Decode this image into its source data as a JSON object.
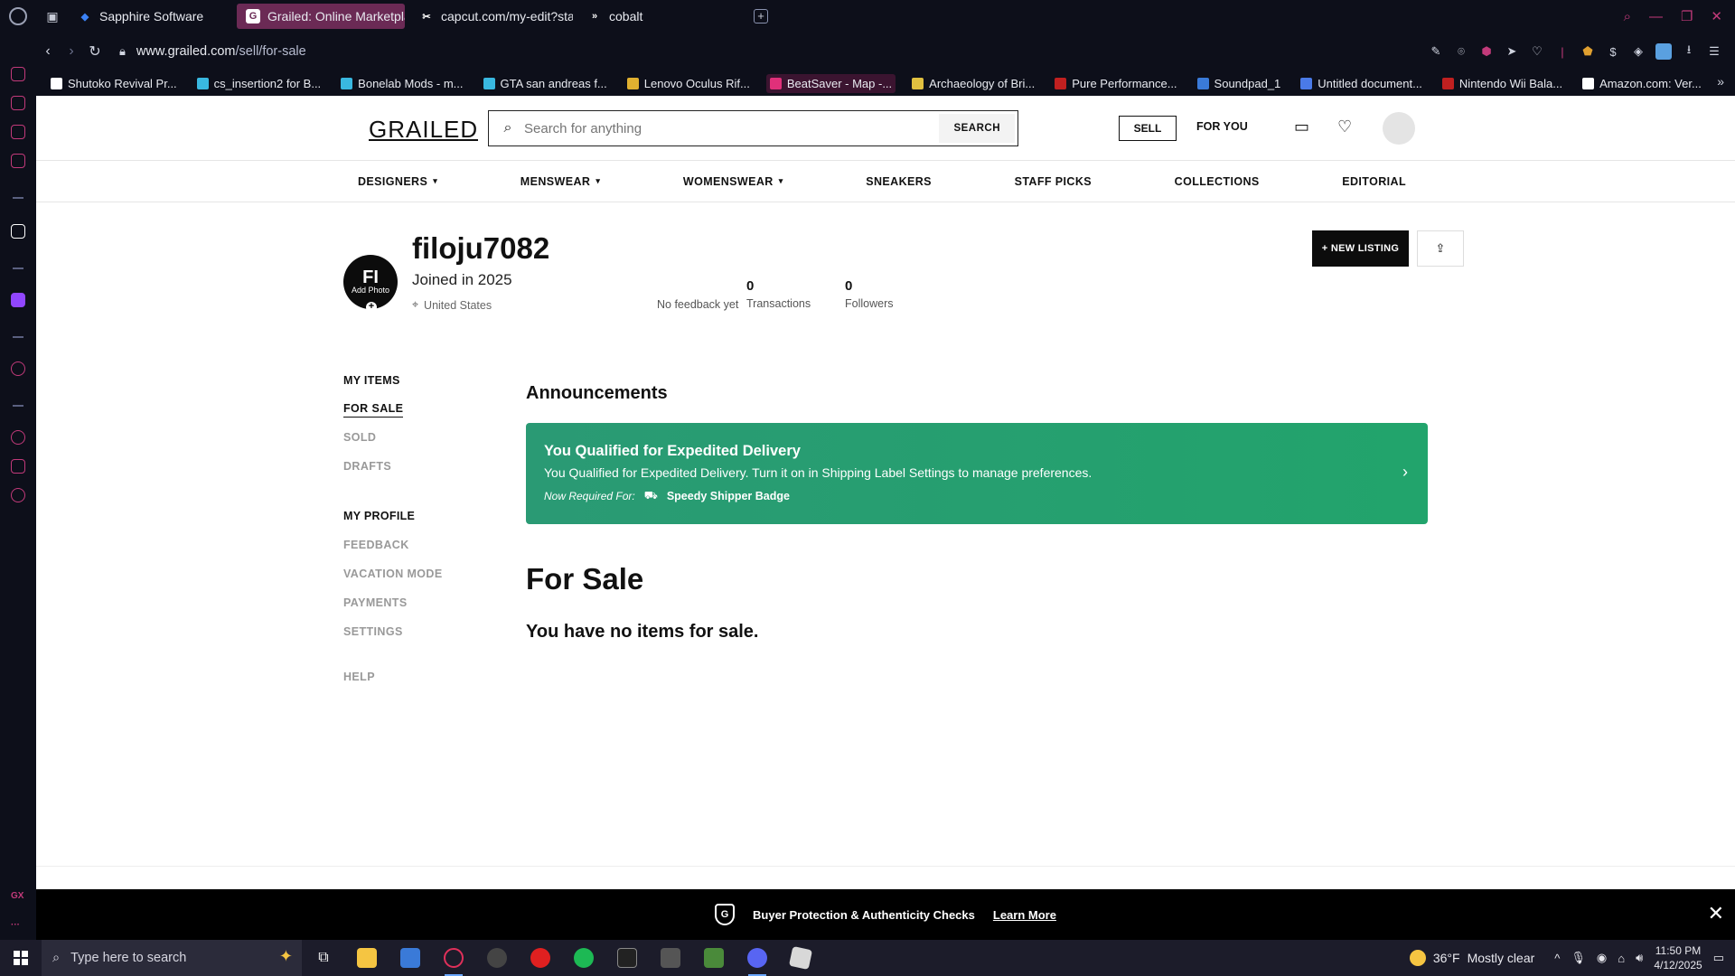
{
  "browser": {
    "tabs": [
      {
        "label": "Sapphire Software",
        "icon": "sapphire-icon",
        "color": "#3b82f6",
        "active": false
      },
      {
        "label": "Grailed: Online Marketplace",
        "icon": "grailed-icon",
        "color": "#ffffff",
        "active": true
      },
      {
        "label": "capcut.com/my-edit?start",
        "icon": "capcut-icon",
        "color": "#ffffff",
        "active": false
      },
      {
        "label": "cobalt",
        "icon": "cobalt-icon",
        "color": "#ffffff",
        "active": false
      }
    ],
    "url_host": "www.grailed.com",
    "url_path": "/sell/for-sale",
    "bookmarks": [
      {
        "label": "Shutoko Revival Pr...",
        "color": "#ffffff"
      },
      {
        "label": "cs_insertion2 for B...",
        "color": "#39b8e0"
      },
      {
        "label": "Bonelab Mods - m...",
        "color": "#39b8e0"
      },
      {
        "label": "GTA san andreas f...",
        "color": "#39b8e0"
      },
      {
        "label": "Lenovo Oculus Rif...",
        "color": "#e0b030"
      },
      {
        "label": "BeatSaver - Map -...",
        "color": "#e0307a"
      },
      {
        "label": "Archaeology of Bri...",
        "color": "#e0c040"
      },
      {
        "label": "Pure Performance...",
        "color": "#c02020"
      },
      {
        "label": "Soundpad_1",
        "color": "#3a7ad8"
      },
      {
        "label": "Untitled document...",
        "color": "#4a7ae8"
      },
      {
        "label": "Nintendo Wii Bala...",
        "color": "#c02020"
      },
      {
        "label": "Amazon.com: Ver...",
        "color": "#ffffff"
      }
    ]
  },
  "site": {
    "logo": "GRAILED",
    "search_placeholder": "Search for anything",
    "search_button": "SEARCH",
    "sell": "SELL",
    "for_you": "FOR YOU",
    "categories": [
      "DESIGNERS",
      "MENSWEAR",
      "WOMENSWEAR",
      "SNEAKERS",
      "STAFF PICKS",
      "COLLECTIONS",
      "EDITORIAL"
    ]
  },
  "profile": {
    "initials": "FI",
    "add_photo": "Add Photo",
    "username": "filoju7082",
    "joined": "Joined in 2025",
    "country": "United States",
    "feedback": "No feedback yet",
    "transactions_count": "0",
    "transactions_label": "Transactions",
    "followers_count": "0",
    "followers_label": "Followers",
    "new_listing": "+ NEW LISTING"
  },
  "leftnav": {
    "my_items": "MY ITEMS",
    "for_sale": "FOR SALE",
    "sold": "SOLD",
    "drafts": "DRAFTS",
    "my_profile": "MY PROFILE",
    "feedback": "FEEDBACK",
    "vacation": "VACATION MODE",
    "payments": "PAYMENTS",
    "settings": "SETTINGS",
    "help": "HELP"
  },
  "main": {
    "announcements": "Announcements",
    "banner_title": "You Qualified for Expedited Delivery",
    "banner_desc": "You Qualified for Expedited Delivery. Turn it on in Shipping Label Settings to manage preferences.",
    "banner_required": "Now Required For:",
    "banner_badge": "Speedy Shipper Badge",
    "for_sale_title": "For Sale",
    "no_items": "You have no items for sale."
  },
  "footer_bar": {
    "text": "Buyer Protection & Authenticity Checks",
    "learn_more": "Learn More"
  },
  "taskbar": {
    "search_placeholder": "Type here to search",
    "temp": "36°F",
    "weather": "Mostly clear",
    "time": "11:50 PM",
    "date": "4/12/2025"
  }
}
